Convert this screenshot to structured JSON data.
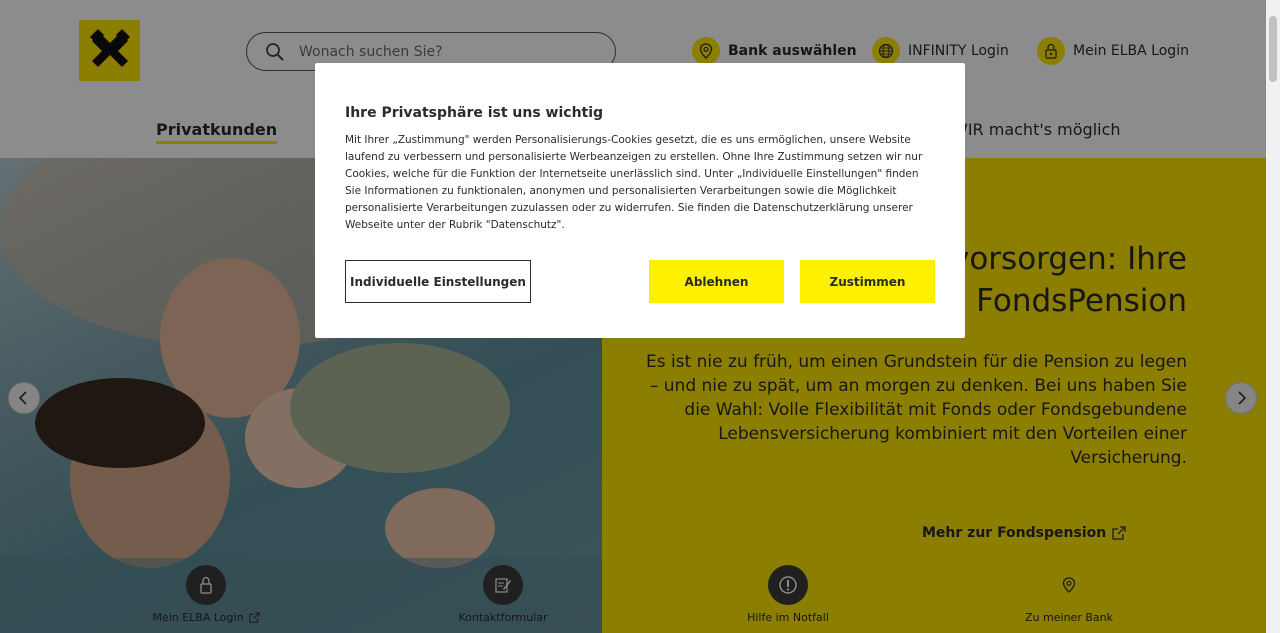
{
  "header": {
    "search_placeholder": "Wonach suchen Sie?",
    "links": [
      {
        "label": "Bank auswählen",
        "icon": "location-pin-icon"
      },
      {
        "label": "INFINITY Login",
        "icon": "globe-icon"
      },
      {
        "label": "Mein ELBA Login",
        "icon": "lock-icon"
      }
    ],
    "nav": {
      "active_tab": "Privatkunden",
      "right_tab": "WIR macht's möglich"
    }
  },
  "hero": {
    "title_line1": "vorsorgen: Ihre",
    "title_line2": "FondsPension",
    "text": "Es ist nie zu früh, um einen Grundstein für die Pension zu legen – und nie zu spät, um an morgen zu denken. Bei uns haben Sie die Wahl: Volle Flexibilität mit Fonds oder Fondsgebundene Lebensversicherung kombiniert mit den Vorteilen einer Versicherung.",
    "link_label": "Mehr zur Fondspension"
  },
  "quick_links": [
    {
      "label": "Mein ELBA Login",
      "icon": "lock-icon"
    },
    {
      "label": "Kontaktformular",
      "icon": "form-edit-icon"
    },
    {
      "label": "Hilfe im Notfall",
      "icon": "exclamation-icon"
    },
    {
      "label": "Zu meiner Bank",
      "icon": "location-pin-icon"
    }
  ],
  "cookie_dialog": {
    "title": "Ihre Privatsphäre ist uns wichtig",
    "body": "Mit Ihrer „Zustimmung\" werden Personalisierungs-Cookies gesetzt, die es uns ermöglichen, unsere Website laufend zu verbessern und personalisierte Werbeanzeigen zu erstellen. Ohne Ihre Zustimmung setzen wir nur Cookies, welche für die Funktion der Internetseite unerlässlich sind. Unter „Individuelle Einstellungen\" finden Sie Informationen zu funktionalen, anonymen und personalisierten Verarbeitungen sowie die Möglichkeit personalisierte Verarbeitungen zuzulassen oder zu widerrufen. Sie finden die Datenschutzerklärung unserer Webseite unter der Rubrik \"Datenschutz\".",
    "settings_label": "Individuelle Einstellungen",
    "reject_label": "Ablehnen",
    "accept_label": "Zustimmen"
  },
  "colors": {
    "brand_yellow": "#fee600",
    "button_yellow": "#fff000",
    "text_dark": "#2b2b2b"
  }
}
